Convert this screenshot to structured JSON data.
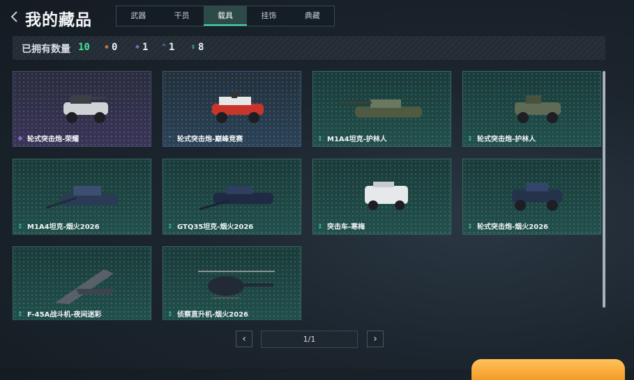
{
  "header": {
    "title": "我的藏品"
  },
  "tabs": [
    {
      "label": "武器"
    },
    {
      "label": "干员"
    },
    {
      "label": "载具"
    },
    {
      "label": "挂饰"
    },
    {
      "label": "典藏"
    }
  ],
  "active_tab": "载具",
  "counts": {
    "label": "已拥有数量",
    "total": "10",
    "items": [
      {
        "icon": "orange-diamond-icon",
        "color": "#e68a3c",
        "value": "0"
      },
      {
        "icon": "purple-diamond-icon",
        "color": "#a57cf0",
        "value": "1"
      },
      {
        "icon": "blue-chevron-icon",
        "color": "#5fa8e8",
        "value": "1"
      },
      {
        "icon": "green-arrows-icon",
        "color": "#40d6a0",
        "value": "8"
      }
    ]
  },
  "items": [
    {
      "name": "轮式突击炮-荣耀",
      "rarity": "purple"
    },
    {
      "name": "轮式突击炮-巅峰竞赛",
      "rarity": "blue"
    },
    {
      "name": "M1A4坦克-护林人",
      "rarity": "green"
    },
    {
      "name": "轮式突击炮-护林人",
      "rarity": "green"
    },
    {
      "name": "M1A4坦克-烟火2026",
      "rarity": "green"
    },
    {
      "name": "GTQ35坦克-烟火2026",
      "rarity": "green"
    },
    {
      "name": "突击车-寒梅",
      "rarity": "green"
    },
    {
      "name": "轮式突击炮-烟火2026",
      "rarity": "green"
    },
    {
      "name": "F-45A战斗机-夜间迷彩",
      "rarity": "green"
    },
    {
      "name": "侦察直升机-烟火2026",
      "rarity": "green"
    }
  ],
  "pagination": {
    "label": "1/1"
  }
}
